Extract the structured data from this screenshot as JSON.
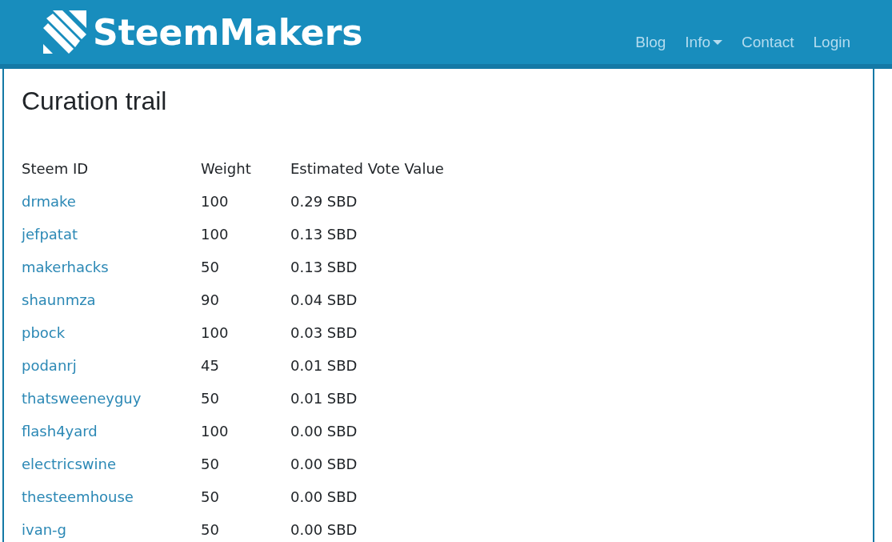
{
  "header": {
    "logo": "SteemMakers",
    "nav": [
      {
        "label": "Blog",
        "dropdown": false
      },
      {
        "label": "Info",
        "dropdown": true
      },
      {
        "label": "Contact",
        "dropdown": false
      },
      {
        "label": "Login",
        "dropdown": false
      }
    ]
  },
  "page": {
    "title": "Curation trail"
  },
  "table": {
    "columns": [
      "Steem ID",
      "Weight",
      "Estimated Vote Value"
    ],
    "rows": [
      {
        "steem_id": "drmake",
        "weight": "100",
        "value": "0.29 SBD"
      },
      {
        "steem_id": "jefpatat",
        "weight": "100",
        "value": "0.13 SBD"
      },
      {
        "steem_id": "makerhacks",
        "weight": "50",
        "value": "0.13 SBD"
      },
      {
        "steem_id": "shaunmza",
        "weight": "90",
        "value": "0.04 SBD"
      },
      {
        "steem_id": "pbock",
        "weight": "100",
        "value": "0.03 SBD"
      },
      {
        "steem_id": "podanrj",
        "weight": "45",
        "value": "0.01 SBD"
      },
      {
        "steem_id": "thatsweeneyguy",
        "weight": "50",
        "value": "0.01 SBD"
      },
      {
        "steem_id": "flash4yard",
        "weight": "100",
        "value": "0.00 SBD"
      },
      {
        "steem_id": "electricswine",
        "weight": "50",
        "value": "0.00 SBD"
      },
      {
        "steem_id": "thesteemhouse",
        "weight": "50",
        "value": "0.00 SBD"
      },
      {
        "steem_id": "ivan-g",
        "weight": "50",
        "value": "0.00 SBD"
      }
    ]
  }
}
